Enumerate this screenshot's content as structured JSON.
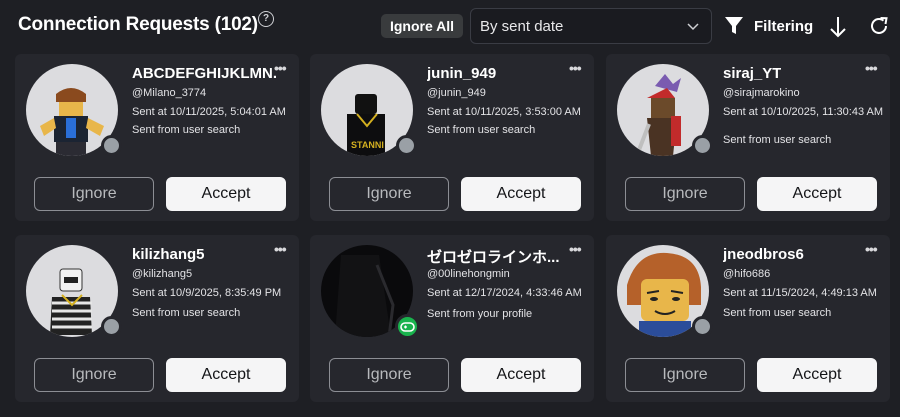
{
  "header": {
    "title": "Connection Requests (102)",
    "help_icon": "?",
    "ignore_all_label": "Ignore All",
    "sort_value": "By sent date",
    "filter_label": "Filtering"
  },
  "cards": [
    {
      "name": "ABCDEFGHIJKLMN...",
      "handle": "@Milano_3774",
      "sent": "Sent at 10/11/2025, 5:04:01 AM",
      "source": "Sent from user search",
      "ignore_label": "Ignore",
      "accept_label": "Accept",
      "presence": "offline"
    },
    {
      "name": "junin_949",
      "handle": "@junin_949",
      "sent": "Sent at 10/11/2025, 3:53:00 AM",
      "source": "Sent from user search",
      "ignore_label": "Ignore",
      "accept_label": "Accept",
      "presence": "offline"
    },
    {
      "name": "siraj_YT",
      "handle": "@sirajmarokino",
      "sent": "Sent at 10/10/2025, 11:30:43 AM",
      "source": "Sent from user search",
      "ignore_label": "Ignore",
      "accept_label": "Accept",
      "presence": "offline"
    },
    {
      "name": "kilizhang5",
      "handle": "@kilizhang5",
      "sent": "Sent at 10/9/2025, 8:35:49 PM",
      "source": "Sent from user search",
      "ignore_label": "Ignore",
      "accept_label": "Accept",
      "presence": "offline"
    },
    {
      "name": "ゼロゼロラインホ...",
      "handle": "@00linehongmin",
      "sent": "Sent at 12/17/2024, 4:33:46 AM",
      "source": "Sent from your profile",
      "ignore_label": "Ignore",
      "accept_label": "Accept",
      "presence": "in-game"
    },
    {
      "name": "jneodbros6",
      "handle": "@hifo686",
      "sent": "Sent at 11/15/2024, 4:49:13 AM",
      "source": "Sent from user search",
      "ignore_label": "Ignore",
      "accept_label": "Accept",
      "presence": "offline"
    }
  ],
  "avatar_texts": {
    "stanni": "STANNI"
  },
  "colors": {
    "background": "#1e1f24",
    "card": "#26272d",
    "accept": "#f5f5f6",
    "offline_dot": "#9aa0a6",
    "game_badge": "#19b34d"
  }
}
